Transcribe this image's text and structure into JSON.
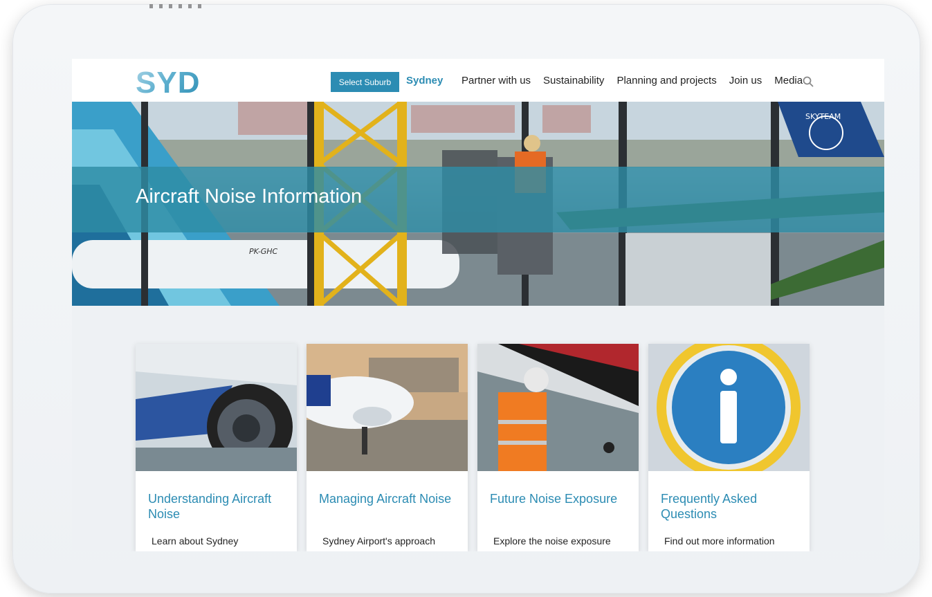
{
  "header": {
    "logo": "SYD",
    "select_suburb_label": "Select Suburb",
    "suburb": "Sydney",
    "nav": [
      {
        "label": "Partner with us"
      },
      {
        "label": "Sustainability"
      },
      {
        "label": "Planning and projects"
      },
      {
        "label": "Join us"
      },
      {
        "label": "Media"
      }
    ],
    "search_icon": "search-icon"
  },
  "hero": {
    "title": "Aircraft Noise Information",
    "image_text": {
      "registration": "PK-GHC",
      "tail_brand": "SKYTEAM"
    }
  },
  "cards": [
    {
      "title": "Understanding Aircraft Noise",
      "text": "Learn about Sydney"
    },
    {
      "title": "Managing Aircraft Noise",
      "text": "Sydney Airport's approach"
    },
    {
      "title": "Future Noise Exposure",
      "text": "Explore the noise exposure"
    },
    {
      "title": "Frequently Asked Questions",
      "text": "Find out more information"
    }
  ],
  "colors": {
    "accent": "#2c8cb3",
    "hero_band": "#2e8ca5",
    "background": "#eef1f4"
  }
}
